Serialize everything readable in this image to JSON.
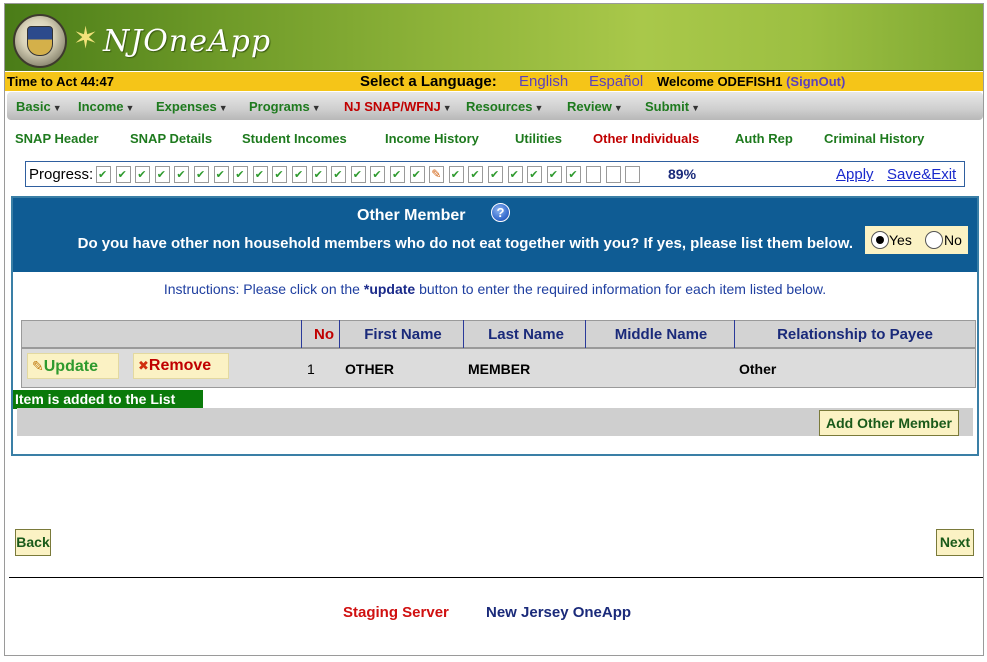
{
  "header": {
    "logo_text": "NJOneApp"
  },
  "infobar": {
    "timer": "Time to Act 44:47",
    "language_label": "Select a Language:",
    "language_english": "English",
    "language_spanish": "Español",
    "welcome": "Welcome ODEFISH1",
    "signout": "(SignOut)"
  },
  "menu": {
    "items": [
      {
        "label": "Basic"
      },
      {
        "label": "Income"
      },
      {
        "label": "Expenses"
      },
      {
        "label": "Programs"
      },
      {
        "label": "NJ SNAP/WFNJ"
      },
      {
        "label": "Resources"
      },
      {
        "label": "Review"
      },
      {
        "label": "Submit"
      }
    ],
    "active": "NJ SNAP/WFNJ"
  },
  "subtabs": {
    "items": [
      {
        "label": "SNAP Header"
      },
      {
        "label": "SNAP Details"
      },
      {
        "label": "Student Incomes"
      },
      {
        "label": "Income History"
      },
      {
        "label": "Utilities"
      },
      {
        "label": "Other Individuals"
      },
      {
        "label": "Auth Rep"
      },
      {
        "label": "Criminal History"
      }
    ],
    "active": "Other Individuals"
  },
  "progress": {
    "label": "Progress:",
    "percent_text": "89%",
    "percent_value": 0.89,
    "steps": [
      "done",
      "done",
      "done",
      "done",
      "done",
      "done",
      "done",
      "done",
      "done",
      "done",
      "done",
      "done",
      "done",
      "done",
      "done",
      "done",
      "done",
      "current",
      "done",
      "done",
      "done",
      "done",
      "done",
      "done",
      "done",
      "empty",
      "empty",
      "empty"
    ],
    "apply_label": "Apply",
    "save_exit_label": "Save&Exit"
  },
  "panel": {
    "title": "Other Member",
    "question": "Do you have other non household members who do not eat together with you? If yes, please list them below.",
    "yes_label": "Yes",
    "no_label": "No",
    "selected": "Yes",
    "instructions_prefix": "Instructions: Please click on the ",
    "instructions_keyword": "*update",
    "instructions_suffix": " button to enter the required information for each item listed below."
  },
  "table": {
    "columns": [
      "No",
      "First Name",
      "Last Name",
      "Middle Name",
      "Relationship to Payee"
    ],
    "rows": [
      {
        "no": "1",
        "first_name": "OTHER",
        "last_name": "MEMBER",
        "middle_name": "",
        "relationship": "Other"
      }
    ],
    "update_label": "Update",
    "remove_label": "Remove"
  },
  "message": "Item is added to the List",
  "add_button": "Add Other Member",
  "nav": {
    "back": "Back",
    "next": "Next"
  },
  "footer": {
    "staging": "Staging Server",
    "name": "New Jersey OneApp"
  },
  "colors": {
    "banner_green": "#8fb43a",
    "infobar_yellow": "#f5c518",
    "menu_green": "#1e7a1e",
    "active_red": "#c00000",
    "panel_blue": "#0f5c94",
    "button_cream": "#fbf2c4",
    "message_green": "#0a7a0a"
  }
}
